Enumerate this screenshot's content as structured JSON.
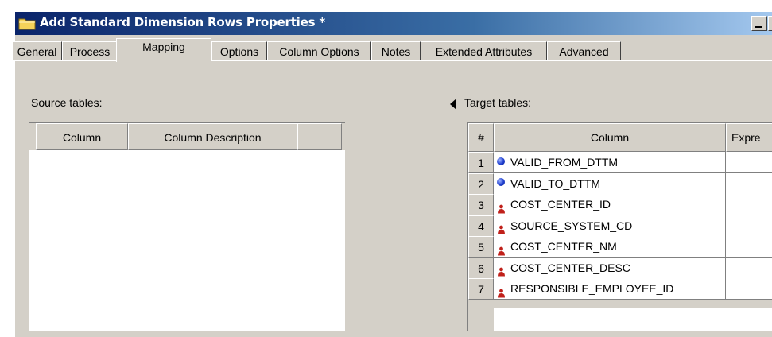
{
  "window": {
    "title": "Add Standard Dimension Rows Properties *",
    "icon": "folder-icon"
  },
  "tabs": [
    {
      "label": "General",
      "active": false
    },
    {
      "label": "Process",
      "active": false
    },
    {
      "label": "Mapping",
      "active": true
    },
    {
      "label": "Options",
      "active": false
    },
    {
      "label": "Column Options",
      "active": false
    },
    {
      "label": "Notes",
      "active": false
    },
    {
      "label": "Extended Attributes",
      "active": false
    },
    {
      "label": "Advanced",
      "active": false
    }
  ],
  "source": {
    "label": "Source tables:",
    "columns": [
      "Column",
      "Column Description",
      ""
    ]
  },
  "target": {
    "label": "Target tables:",
    "columns": [
      "#",
      "Column",
      "Expre"
    ],
    "rows": [
      {
        "num": "1",
        "name": "VALID_FROM_DTTM",
        "icon": "blue-dot-icon"
      },
      {
        "num": "2",
        "name": "VALID_TO_DTTM",
        "icon": "blue-dot-icon"
      },
      {
        "num": "3",
        "name": "COST_CENTER_ID",
        "icon": "red-person-icon"
      },
      {
        "num": "4",
        "name": "SOURCE_SYSTEM_CD",
        "icon": "red-person-icon"
      },
      {
        "num": "5",
        "name": "COST_CENTER_NM",
        "icon": "red-person-icon"
      },
      {
        "num": "6",
        "name": "COST_CENTER_DESC",
        "icon": "red-person-icon"
      },
      {
        "num": "7",
        "name": "RESPONSIBLE_EMPLOYEE_ID",
        "icon": "red-person-icon"
      }
    ]
  },
  "colors": {
    "titlebar_start": "#0a246a",
    "titlebar_end": "#a6caf0",
    "face": "#d4d0c8",
    "key_icon": "#c0201a",
    "dot_icon": "#1f3fd0"
  }
}
